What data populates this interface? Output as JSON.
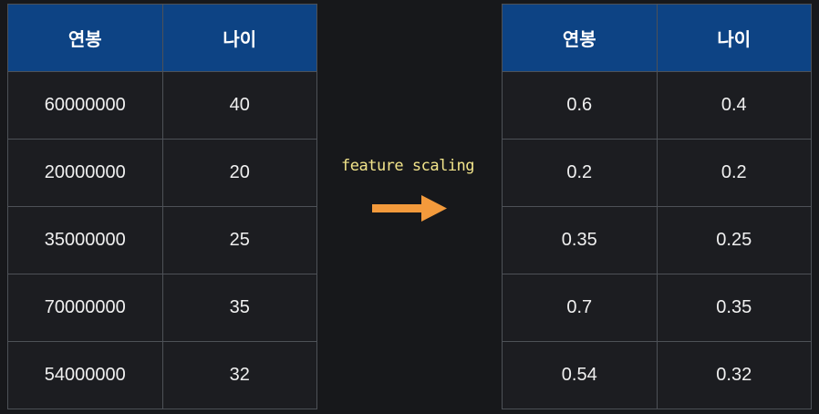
{
  "left_table": {
    "headers": [
      "연봉",
      "나이"
    ],
    "rows": [
      [
        "60000000",
        "40"
      ],
      [
        "20000000",
        "20"
      ],
      [
        "35000000",
        "25"
      ],
      [
        "70000000",
        "35"
      ],
      [
        "54000000",
        "32"
      ]
    ]
  },
  "transform": {
    "label": "feature scaling",
    "arrow_color": "#f39a3c"
  },
  "right_table": {
    "headers": [
      "연봉",
      "나이"
    ],
    "rows": [
      [
        "0.6",
        "0.4"
      ],
      [
        "0.2",
        "0.2"
      ],
      [
        "0.35",
        "0.25"
      ],
      [
        "0.7",
        "0.35"
      ],
      [
        "0.54",
        "0.32"
      ]
    ]
  },
  "colors": {
    "header_bg": "#0d4384",
    "cell_bg": "#1c1d21",
    "page_bg": "#17181b",
    "label_color": "#f2e48a"
  }
}
